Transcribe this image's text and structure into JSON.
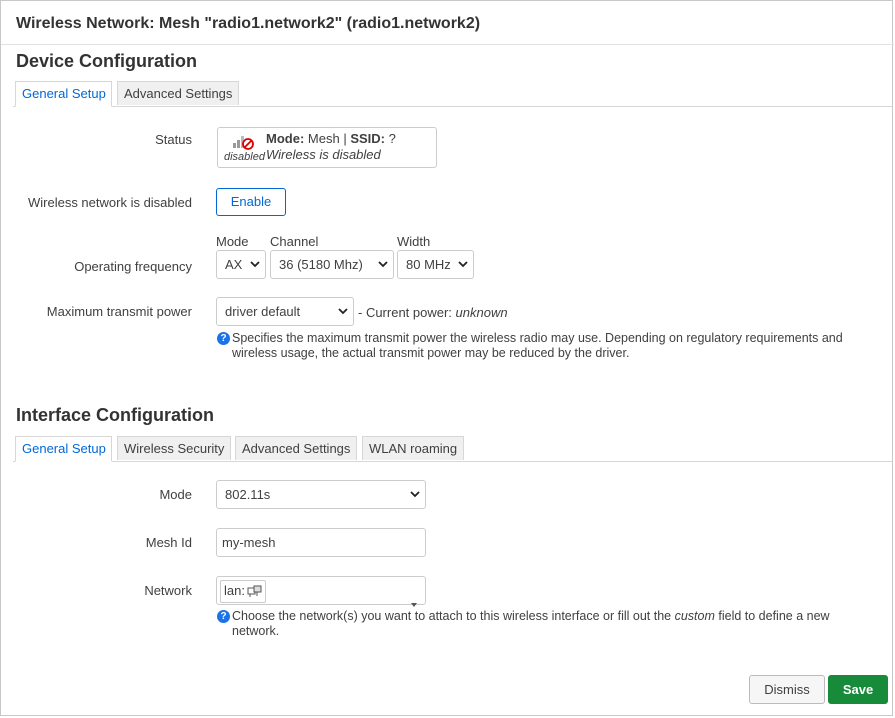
{
  "title": "Wireless Network: Mesh \"radio1.network2\" (radio1.network2)",
  "device": {
    "heading": "Device Configuration",
    "tabs": [
      "General Setup",
      "Advanced Settings"
    ],
    "status": {
      "label": "Status",
      "icon": "wireless-disabled-icon",
      "icon_caption": "disabled",
      "mode_key": "Mode:",
      "mode_val": "Mesh",
      "sep": "|",
      "ssid_key": "SSID:",
      "ssid_val": "?",
      "state": "Wireless is disabled"
    },
    "disabled": {
      "label": "Wireless network is disabled",
      "button": "Enable"
    },
    "frequency": {
      "label": "Operating frequency",
      "mode_label": "Mode",
      "mode_value": "AX",
      "channel_label": "Channel",
      "channel_value": "36 (5180 Mhz)",
      "width_label": "Width",
      "width_value": "80 MHz"
    },
    "txpower": {
      "label": "Maximum transmit power",
      "value": "driver default",
      "current_prefix": "- Current power:",
      "current_value": "unknown",
      "help_line1": "Specifies the maximum transmit power the wireless radio may use. Depending on regulatory requirements and",
      "help_line2": "wireless usage, the actual transmit power may be reduced by the driver."
    }
  },
  "iface": {
    "heading": "Interface Configuration",
    "tabs": [
      "General Setup",
      "Wireless Security",
      "Advanced Settings",
      "WLAN roaming"
    ],
    "mode": {
      "label": "Mode",
      "value": "802.11s"
    },
    "meshid": {
      "label": "Mesh Id",
      "value": "my-mesh"
    },
    "network": {
      "label": "Network",
      "value": "lan:",
      "help_pre": "Choose the network(s) you want to attach to this wireless interface or fill out the",
      "help_em": "custom",
      "help_post": "field to define a new",
      "help_line2": "network."
    }
  },
  "footer": {
    "dismiss": "Dismiss",
    "save": "Save"
  },
  "colors": {
    "accent": "#0069d6",
    "save": "#188b3a",
    "help": "#1a73e8"
  }
}
